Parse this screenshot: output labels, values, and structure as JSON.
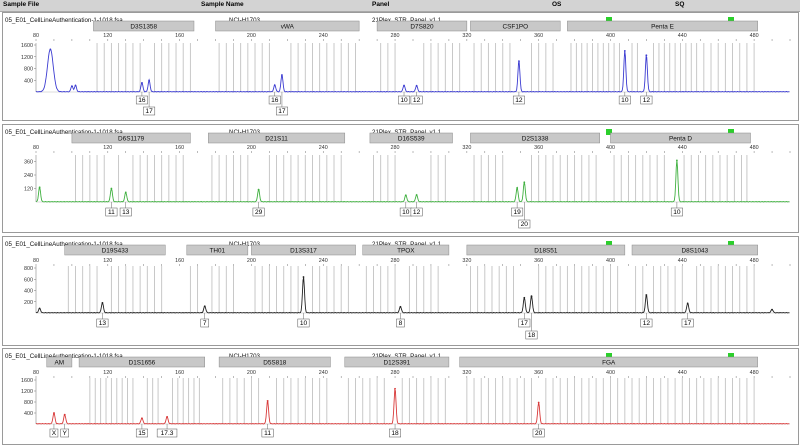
{
  "header": {
    "sample_file": "Sample File",
    "sample_name": "Sample Name",
    "panel": "Panel",
    "os": "OS",
    "sq": "SQ"
  },
  "colors": {
    "header_bg": "#d3d3d3",
    "marker_bar": "#c8c8c8",
    "bin": "#c2c2c2",
    "quality_ok": "#2bcf2b"
  },
  "chart_data": [
    {
      "type": "line",
      "channel": "blue",
      "color": "#3b3bd1",
      "sample_file": "05_E01_CellLineAuthentication-1-1018.fsa",
      "sample_name": "NCI-H1703",
      "panel": "21Plex_STR_Panel_v1.1",
      "xlim": [
        80,
        500
      ],
      "ylim": [
        0,
        1600
      ],
      "x_ticks": [
        "80",
        "120",
        "160",
        "200",
        "240",
        "280",
        "320",
        "360",
        "400",
        "440",
        "480"
      ],
      "y_ticks": [
        "400",
        "800",
        "1200",
        "1600"
      ],
      "markers": [
        {
          "name": "D3S1358",
          "range": [
            112,
            168
          ]
        },
        {
          "name": "vWA",
          "range": [
            180,
            260
          ]
        },
        {
          "name": "D7S820",
          "range": [
            270,
            320
          ]
        },
        {
          "name": "CSF1PO",
          "range": [
            322,
            372
          ]
        },
        {
          "name": "Penta E",
          "range": [
            376,
            482
          ]
        }
      ],
      "peaks": [
        {
          "x": 88,
          "y": 1450
        },
        {
          "x": 100,
          "y": 200
        },
        {
          "x": 102,
          "y": 220
        },
        {
          "x": 139,
          "y": 310
        },
        {
          "x": 143,
          "y": 390
        },
        {
          "x": 213,
          "y": 230
        },
        {
          "x": 217,
          "y": 580
        },
        {
          "x": 285,
          "y": 220
        },
        {
          "x": 292,
          "y": 210
        },
        {
          "x": 349,
          "y": 1050
        },
        {
          "x": 408,
          "y": 1400
        },
        {
          "x": 420,
          "y": 1250
        }
      ],
      "alleles": [
        {
          "label": "16",
          "x": 139,
          "row": 0
        },
        {
          "label": "17",
          "x": 143,
          "row": 1
        },
        {
          "label": "16",
          "x": 213,
          "row": 0
        },
        {
          "label": "17",
          "x": 217,
          "row": 1
        },
        {
          "label": "10",
          "x": 285,
          "row": 0
        },
        {
          "label": "12",
          "x": 292,
          "row": 0
        },
        {
          "label": "12",
          "x": 349,
          "row": 0
        },
        {
          "label": "10",
          "x": 408,
          "row": 0
        },
        {
          "label": "12",
          "x": 420,
          "row": 0
        }
      ],
      "bins": [
        114,
        118,
        122,
        126,
        130,
        134,
        138,
        146,
        150,
        154,
        158,
        162,
        166,
        182,
        186,
        190,
        194,
        198,
        202,
        206,
        210,
        222,
        226,
        230,
        234,
        238,
        242,
        246,
        250,
        254,
        258,
        272,
        276,
        280,
        296,
        300,
        304,
        308,
        312,
        316,
        324,
        328,
        332,
        336,
        340,
        344,
        356,
        360,
        364,
        368,
        378,
        381,
        384,
        387,
        390,
        393,
        396,
        399,
        402,
        405,
        412,
        415,
        424,
        427,
        430,
        433,
        436,
        439,
        442,
        445,
        448,
        452,
        456,
        460,
        464,
        468,
        472,
        476,
        480
      ]
    },
    {
      "type": "line",
      "channel": "green",
      "color": "#3fb03f",
      "sample_file": "05_E01_CellLineAuthentication-1-1018.fsa",
      "sample_name": "NCI-H1703",
      "panel": "21Plex_STR_Panel_v1.1",
      "xlim": [
        80,
        500
      ],
      "ylim": [
        0,
        400
      ],
      "x_ticks": [
        "80",
        "120",
        "160",
        "200",
        "240",
        "280",
        "320",
        "360",
        "400",
        "440",
        "480"
      ],
      "y_ticks": [
        "120",
        "240",
        "360"
      ],
      "markers": [
        {
          "name": "D6S1179",
          "range": [
            100,
            166
          ]
        },
        {
          "name": "D21S11",
          "range": [
            176,
            252
          ]
        },
        {
          "name": "D16S539",
          "range": [
            266,
            312
          ]
        },
        {
          "name": "D2S1338",
          "range": [
            322,
            394
          ]
        },
        {
          "name": "Penta D",
          "range": [
            400,
            478
          ]
        }
      ],
      "peaks": [
        {
          "x": 82,
          "y": 130
        },
        {
          "x": 122,
          "y": 120
        },
        {
          "x": 130,
          "y": 85
        },
        {
          "x": 204,
          "y": 110
        },
        {
          "x": 286,
          "y": 60
        },
        {
          "x": 292,
          "y": 62
        },
        {
          "x": 348,
          "y": 125
        },
        {
          "x": 352,
          "y": 175
        },
        {
          "x": 437,
          "y": 370
        }
      ],
      "alleles": [
        {
          "label": "11",
          "x": 122,
          "row": 0
        },
        {
          "label": "13",
          "x": 130,
          "row": 0
        },
        {
          "label": "29",
          "x": 204,
          "row": 0
        },
        {
          "label": "10",
          "x": 286,
          "row": 0
        },
        {
          "label": "12",
          "x": 292,
          "row": 0
        },
        {
          "label": "19",
          "x": 348,
          "row": 0
        },
        {
          "label": "20",
          "x": 352,
          "row": 1
        },
        {
          "label": "10",
          "x": 437,
          "row": 0
        }
      ],
      "bins": [
        102,
        106,
        110,
        114,
        118,
        126,
        134,
        138,
        142,
        146,
        150,
        154,
        158,
        162,
        178,
        182,
        186,
        190,
        194,
        198,
        210,
        214,
        218,
        222,
        226,
        230,
        234,
        238,
        242,
        246,
        250,
        268,
        272,
        276,
        280,
        300,
        304,
        308,
        324,
        328,
        332,
        336,
        340,
        356,
        360,
        364,
        368,
        372,
        376,
        380,
        384,
        388,
        392,
        402,
        406,
        410,
        414,
        418,
        422,
        426,
        430,
        441,
        445,
        449,
        453,
        457,
        461,
        465,
        469,
        473,
        476
      ]
    },
    {
      "type": "line",
      "channel": "black",
      "color": "#222222",
      "sample_file": "05_E01_CellLineAuthentication-1-1018.fsa",
      "sample_name": "NCI-H1703",
      "panel": "21Plex_STR_Panel_v1.1",
      "xlim": [
        80,
        500
      ],
      "ylim": [
        0,
        800
      ],
      "x_ticks": [
        "80",
        "120",
        "160",
        "200",
        "240",
        "280",
        "320",
        "360",
        "400",
        "440",
        "480"
      ],
      "y_ticks": [
        "200",
        "400",
        "600",
        "800"
      ],
      "markers": [
        {
          "name": "D19S433",
          "range": [
            96,
            152
          ]
        },
        {
          "name": "TH01",
          "range": [
            164,
            198
          ]
        },
        {
          "name": "D13S317",
          "range": [
            200,
            258
          ]
        },
        {
          "name": "TPOX",
          "range": [
            262,
            310
          ]
        },
        {
          "name": "D18S51",
          "range": [
            320,
            408
          ]
        },
        {
          "name": "D8S1043",
          "range": [
            412,
            482
          ]
        }
      ],
      "peaks": [
        {
          "x": 82,
          "y": 80
        },
        {
          "x": 117,
          "y": 180
        },
        {
          "x": 174,
          "y": 120
        },
        {
          "x": 229,
          "y": 640
        },
        {
          "x": 283,
          "y": 110
        },
        {
          "x": 352,
          "y": 270
        },
        {
          "x": 356,
          "y": 300
        },
        {
          "x": 420,
          "y": 320
        },
        {
          "x": 443,
          "y": 170
        },
        {
          "x": 490,
          "y": 60
        }
      ],
      "alleles": [
        {
          "label": "13",
          "x": 117,
          "row": 0
        },
        {
          "label": "7",
          "x": 174,
          "row": 0
        },
        {
          "label": "10",
          "x": 229,
          "row": 0
        },
        {
          "label": "8",
          "x": 283,
          "row": 0
        },
        {
          "label": "17",
          "x": 352,
          "row": 0
        },
        {
          "label": "18",
          "x": 356,
          "row": 1
        },
        {
          "label": "12",
          "x": 420,
          "row": 0
        },
        {
          "label": "17",
          "x": 443,
          "row": 0
        }
      ],
      "bins": [
        98,
        102,
        106,
        110,
        114,
        122,
        126,
        130,
        134,
        138,
        142,
        146,
        150,
        166,
        170,
        178,
        182,
        186,
        190,
        202,
        206,
        210,
        214,
        218,
        222,
        226,
        234,
        238,
        242,
        246,
        250,
        254,
        264,
        268,
        272,
        276,
        280,
        288,
        292,
        296,
        300,
        304,
        322,
        326,
        330,
        334,
        338,
        342,
        346,
        360,
        364,
        368,
        372,
        376,
        380,
        384,
        388,
        392,
        396,
        400,
        404,
        414,
        418,
        424,
        428,
        432,
        436,
        440,
        448,
        452,
        456,
        460,
        464,
        468,
        472,
        476,
        480
      ]
    },
    {
      "type": "line",
      "channel": "red",
      "color": "#d83a3a",
      "sample_file": "05_E01_CellLineAuthentication-1-1018.fsa",
      "sample_name": "NCI-H1703",
      "panel": "21Plex_STR_Panel_v1.1",
      "xlim": [
        80,
        500
      ],
      "ylim": [
        0,
        1600
      ],
      "x_ticks": [
        "80",
        "120",
        "160",
        "200",
        "240",
        "280",
        "320",
        "360",
        "400",
        "440",
        "480"
      ],
      "y_ticks": [
        "400",
        "800",
        "1200",
        "1600"
      ],
      "markers": [
        {
          "name": "AM",
          "range": [
            86,
            100
          ]
        },
        {
          "name": "D1S1656",
          "range": [
            104,
            174
          ]
        },
        {
          "name": "D5S818",
          "range": [
            182,
            244
          ]
        },
        {
          "name": "D12S391",
          "range": [
            252,
            310
          ]
        },
        {
          "name": "FGA",
          "range": [
            316,
            482
          ]
        }
      ],
      "peaks": [
        {
          "x": 90,
          "y": 400
        },
        {
          "x": 96,
          "y": 340
        },
        {
          "x": 139,
          "y": 210
        },
        {
          "x": 153,
          "y": 260
        },
        {
          "x": 209,
          "y": 840
        },
        {
          "x": 280,
          "y": 1280
        },
        {
          "x": 360,
          "y": 780
        }
      ],
      "alleles": [
        {
          "label": "X",
          "x": 90,
          "row": 0
        },
        {
          "label": "Y",
          "x": 96,
          "row": 0
        },
        {
          "label": "15",
          "x": 139,
          "row": 0
        },
        {
          "label": "17.3",
          "x": 153,
          "row": 0
        },
        {
          "label": "11",
          "x": 209,
          "row": 0
        },
        {
          "label": "18",
          "x": 280,
          "row": 0
        },
        {
          "label": "20",
          "x": 360,
          "row": 0
        }
      ],
      "bins": [
        110,
        113,
        116,
        119,
        122,
        125,
        128,
        131,
        134,
        142,
        145,
        148,
        156,
        159,
        162,
        165,
        168,
        171,
        184,
        188,
        192,
        196,
        200,
        204,
        214,
        218,
        222,
        226,
        230,
        234,
        238,
        242,
        254,
        258,
        262,
        266,
        270,
        274,
        284,
        288,
        292,
        296,
        300,
        304,
        308,
        320,
        324,
        328,
        332,
        336,
        340,
        344,
        348,
        352,
        356,
        364,
        368,
        372,
        376,
        380,
        384,
        388,
        392,
        396,
        400,
        404,
        408,
        412,
        416,
        420,
        424,
        428,
        432,
        436,
        440,
        444,
        448,
        452,
        456,
        460,
        464,
        468,
        472,
        476,
        480
      ]
    }
  ]
}
